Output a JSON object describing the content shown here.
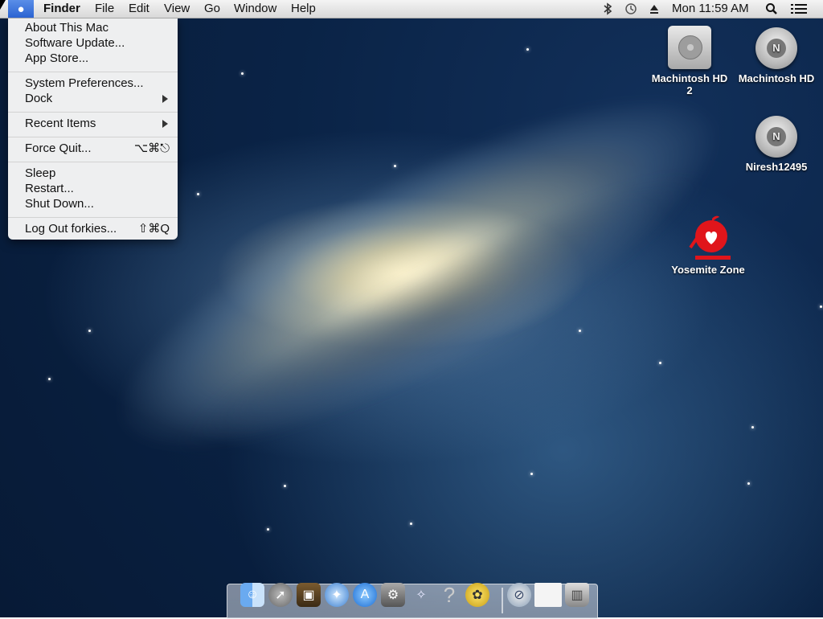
{
  "menubar": {
    "app_name": "Finder",
    "menus": [
      "File",
      "Edit",
      "View",
      "Go",
      "Window",
      "Help"
    ],
    "clock": "Mon 11:59 AM",
    "status_icons": [
      "bluetooth-icon",
      "time-machine-icon",
      "eject-icon",
      "spotlight-icon",
      "notification-center-icon"
    ]
  },
  "apple_menu": {
    "items": [
      {
        "label": "About This Mac"
      },
      {
        "label": "Software Update..."
      },
      {
        "label": "App Store..."
      },
      {
        "label": "System Preferences..."
      },
      {
        "label": "Dock"
      },
      {
        "label": "Recent Items"
      },
      {
        "label": "Force Quit...",
        "shortcut": "⌥⌘⎋"
      },
      {
        "label": "Sleep"
      },
      {
        "label": "Restart..."
      },
      {
        "label": "Shut Down..."
      },
      {
        "label": "Log Out forkies...",
        "shortcut": "⇧⌘Q"
      }
    ]
  },
  "desktop_icons": [
    {
      "label": "Machintosh HD 2",
      "icon": "hard-drive-icon"
    },
    {
      "label": "Machintosh HD",
      "icon": "disk-icon"
    },
    {
      "label": "Niresh12495",
      "icon": "disk-icon"
    },
    {
      "label": "Yosemite Zone",
      "icon": "yosemite-zone-icon"
    }
  ],
  "dock": {
    "apps": [
      "finder-icon",
      "launchpad-icon",
      "photo-booth-icon",
      "safari-icon",
      "app-store-icon",
      "system-preferences-icon",
      "wizard-icon",
      "help-icon",
      "bee-icon",
      "downloads-stack-icon",
      "document-stack-icon",
      "trash-icon"
    ]
  }
}
